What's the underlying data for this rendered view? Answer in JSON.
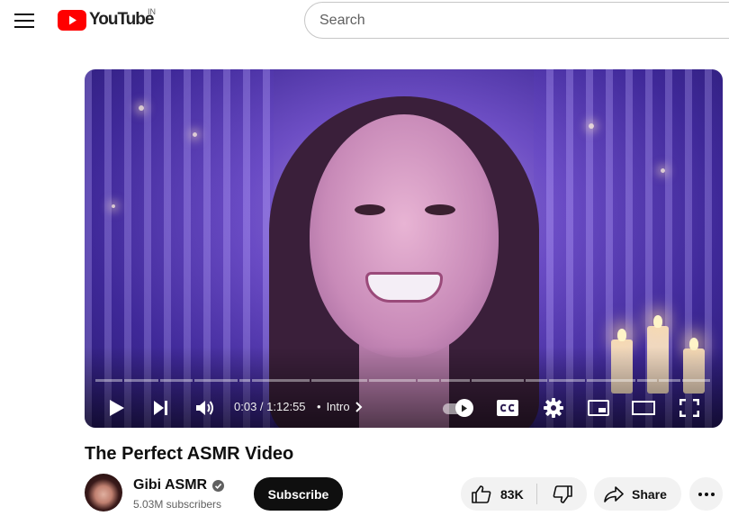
{
  "masthead": {
    "menu_icon": "hamburger-menu-icon",
    "logo_text": "YouTube",
    "country_code": "IN",
    "search_placeholder": "Search"
  },
  "player": {
    "current_time": "0:03",
    "separator": " / ",
    "duration": "1:12:55",
    "chapter_bullet": "•",
    "chapter_title": "Intro",
    "progress_fraction": 0.0007,
    "autoplay_on": true
  },
  "video": {
    "title": "The Perfect ASMR Video"
  },
  "channel": {
    "name": "Gibi ASMR",
    "verified": true,
    "subscribers": "5.03M subscribers",
    "subscribe_label": "Subscribe"
  },
  "actions": {
    "like_count": "83K",
    "share_label": "Share"
  },
  "colors": {
    "brand_red": "#ff0000",
    "text_primary": "#0f0f0f",
    "text_secondary": "#606060",
    "pill_bg": "#f2f2f2"
  }
}
